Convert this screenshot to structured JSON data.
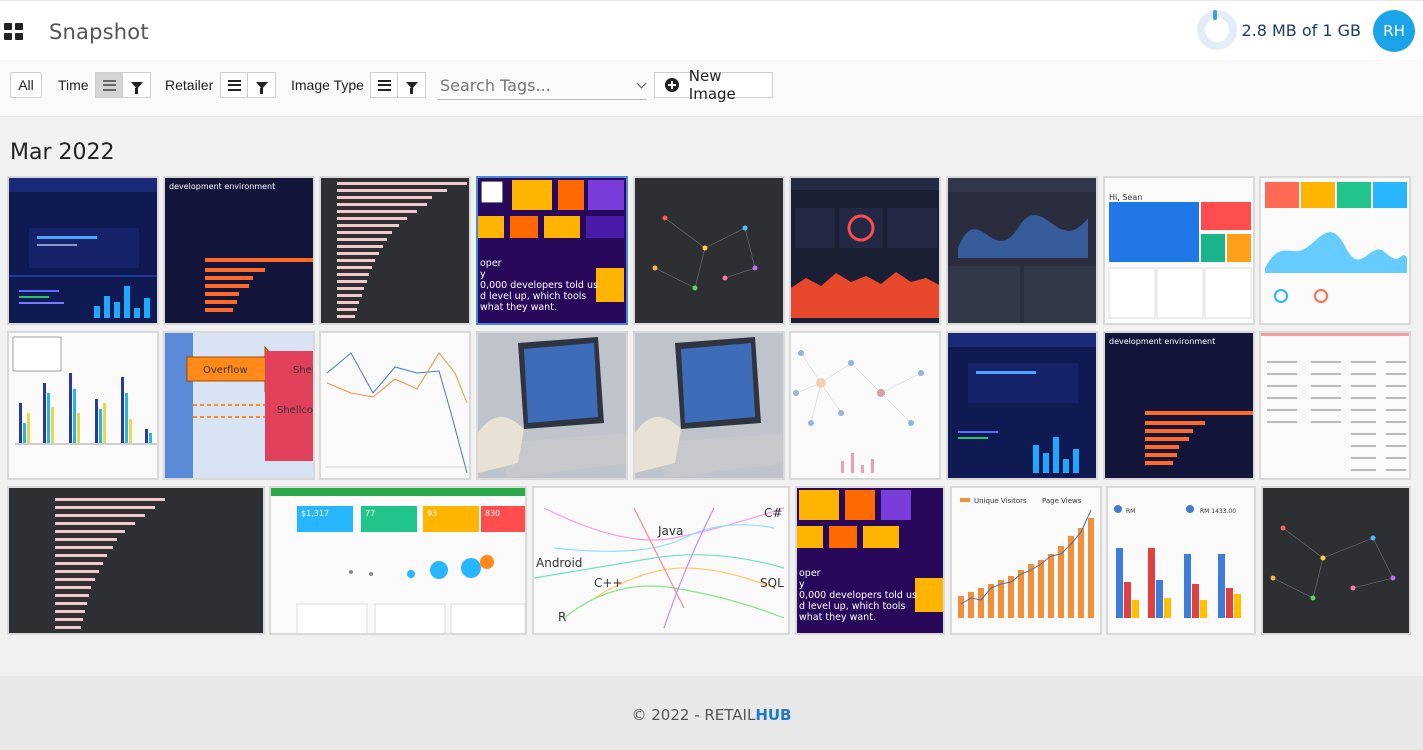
{
  "header": {
    "title": "Snapshot",
    "storage_text": "2.8 MB of 1 GB",
    "avatar_initials": "RH"
  },
  "toolbar": {
    "all_label": "All",
    "time_label": "Time",
    "retailer_label": "Retailer",
    "image_type_label": "Image Type",
    "search_placeholder": "Search Tags...",
    "new_image_label": "New Image"
  },
  "gallery": {
    "month": "Mar 2022",
    "thumb_texts": {
      "dev_env": "development environment",
      "developer_told": "oper\ny\n0,000 developers told us\nd level up, which tools\nwhat they want.",
      "overflow": "Overflow",
      "shell": "Shel",
      "shellcode": "Shellcod",
      "android": "Android",
      "java": "Java",
      "cpp": "C++",
      "csharp": "C#",
      "sql": "SQL",
      "r": "R",
      "unique_visitors": "Unique Visitors",
      "page_views": "Page Views",
      "dashboard_val1": "$1,317",
      "dashboard_val2": "77",
      "dashboard_val3": "93",
      "dashboard_val4": "830",
      "hi_sean": "Hi, Sean",
      "rm": "RM",
      "rm_1433": "RM 1433.00"
    }
  },
  "footer": {
    "prefix": "© 2022 - RETAIL",
    "brand": "HUB"
  },
  "colors": {
    "accent": "#1aa3e8",
    "brand": "#1f78c7",
    "selected_border": "#4a88d8"
  }
}
